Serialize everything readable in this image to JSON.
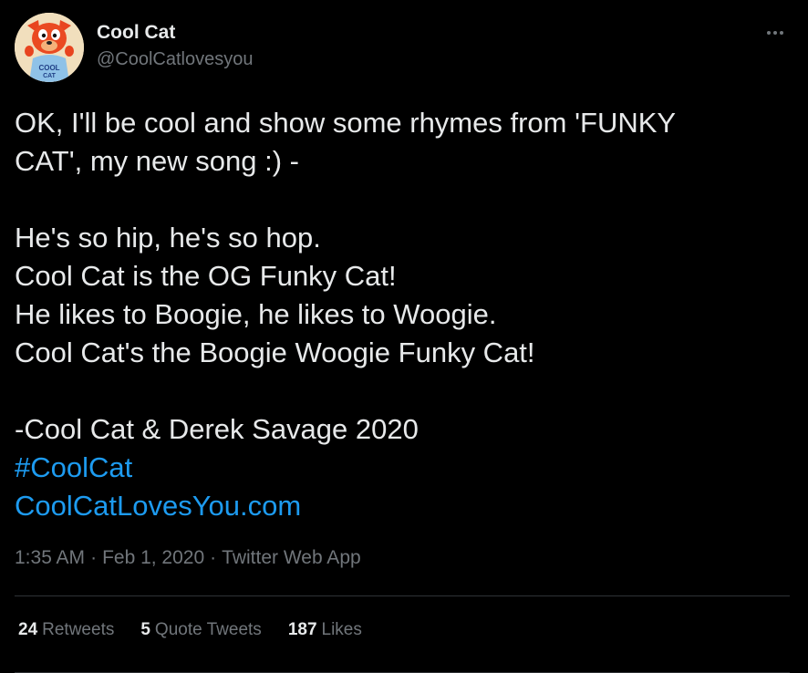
{
  "author": {
    "display_name": "Cool Cat",
    "handle": "@CoolCatlovesyou",
    "avatar_shirt_text": "COOL CAT",
    "avatar_icon": "cool-cat-mascot"
  },
  "tweet": {
    "lines": [
      "OK, I'll be cool and show some rhymes from 'FUNKY",
      "CAT', my new song :) -",
      "",
      "He's so hip, he's so hop.",
      "Cool Cat is the OG Funky Cat!",
      "He likes to Boogie, he likes to Woogie.",
      "Cool Cat's the Boogie Woogie Funky Cat!",
      "",
      "-Cool Cat & Derek Savage 2020"
    ],
    "hashtag": "#CoolCat",
    "link": "CoolCatLovesYou.com"
  },
  "meta": {
    "time": "1:35 AM",
    "date": "Feb 1, 2020",
    "source": "Twitter Web App",
    "separator": "·"
  },
  "stats": {
    "retweets": {
      "count": "24",
      "label": "Retweets"
    },
    "quote_tweets": {
      "count": "5",
      "label": "Quote Tweets"
    },
    "likes": {
      "count": "187",
      "label": "Likes"
    }
  },
  "colors": {
    "background": "#000000",
    "text": "#e7e9ea",
    "secondary": "#71767b",
    "link": "#1d9bf0",
    "divider": "#2f3336"
  }
}
